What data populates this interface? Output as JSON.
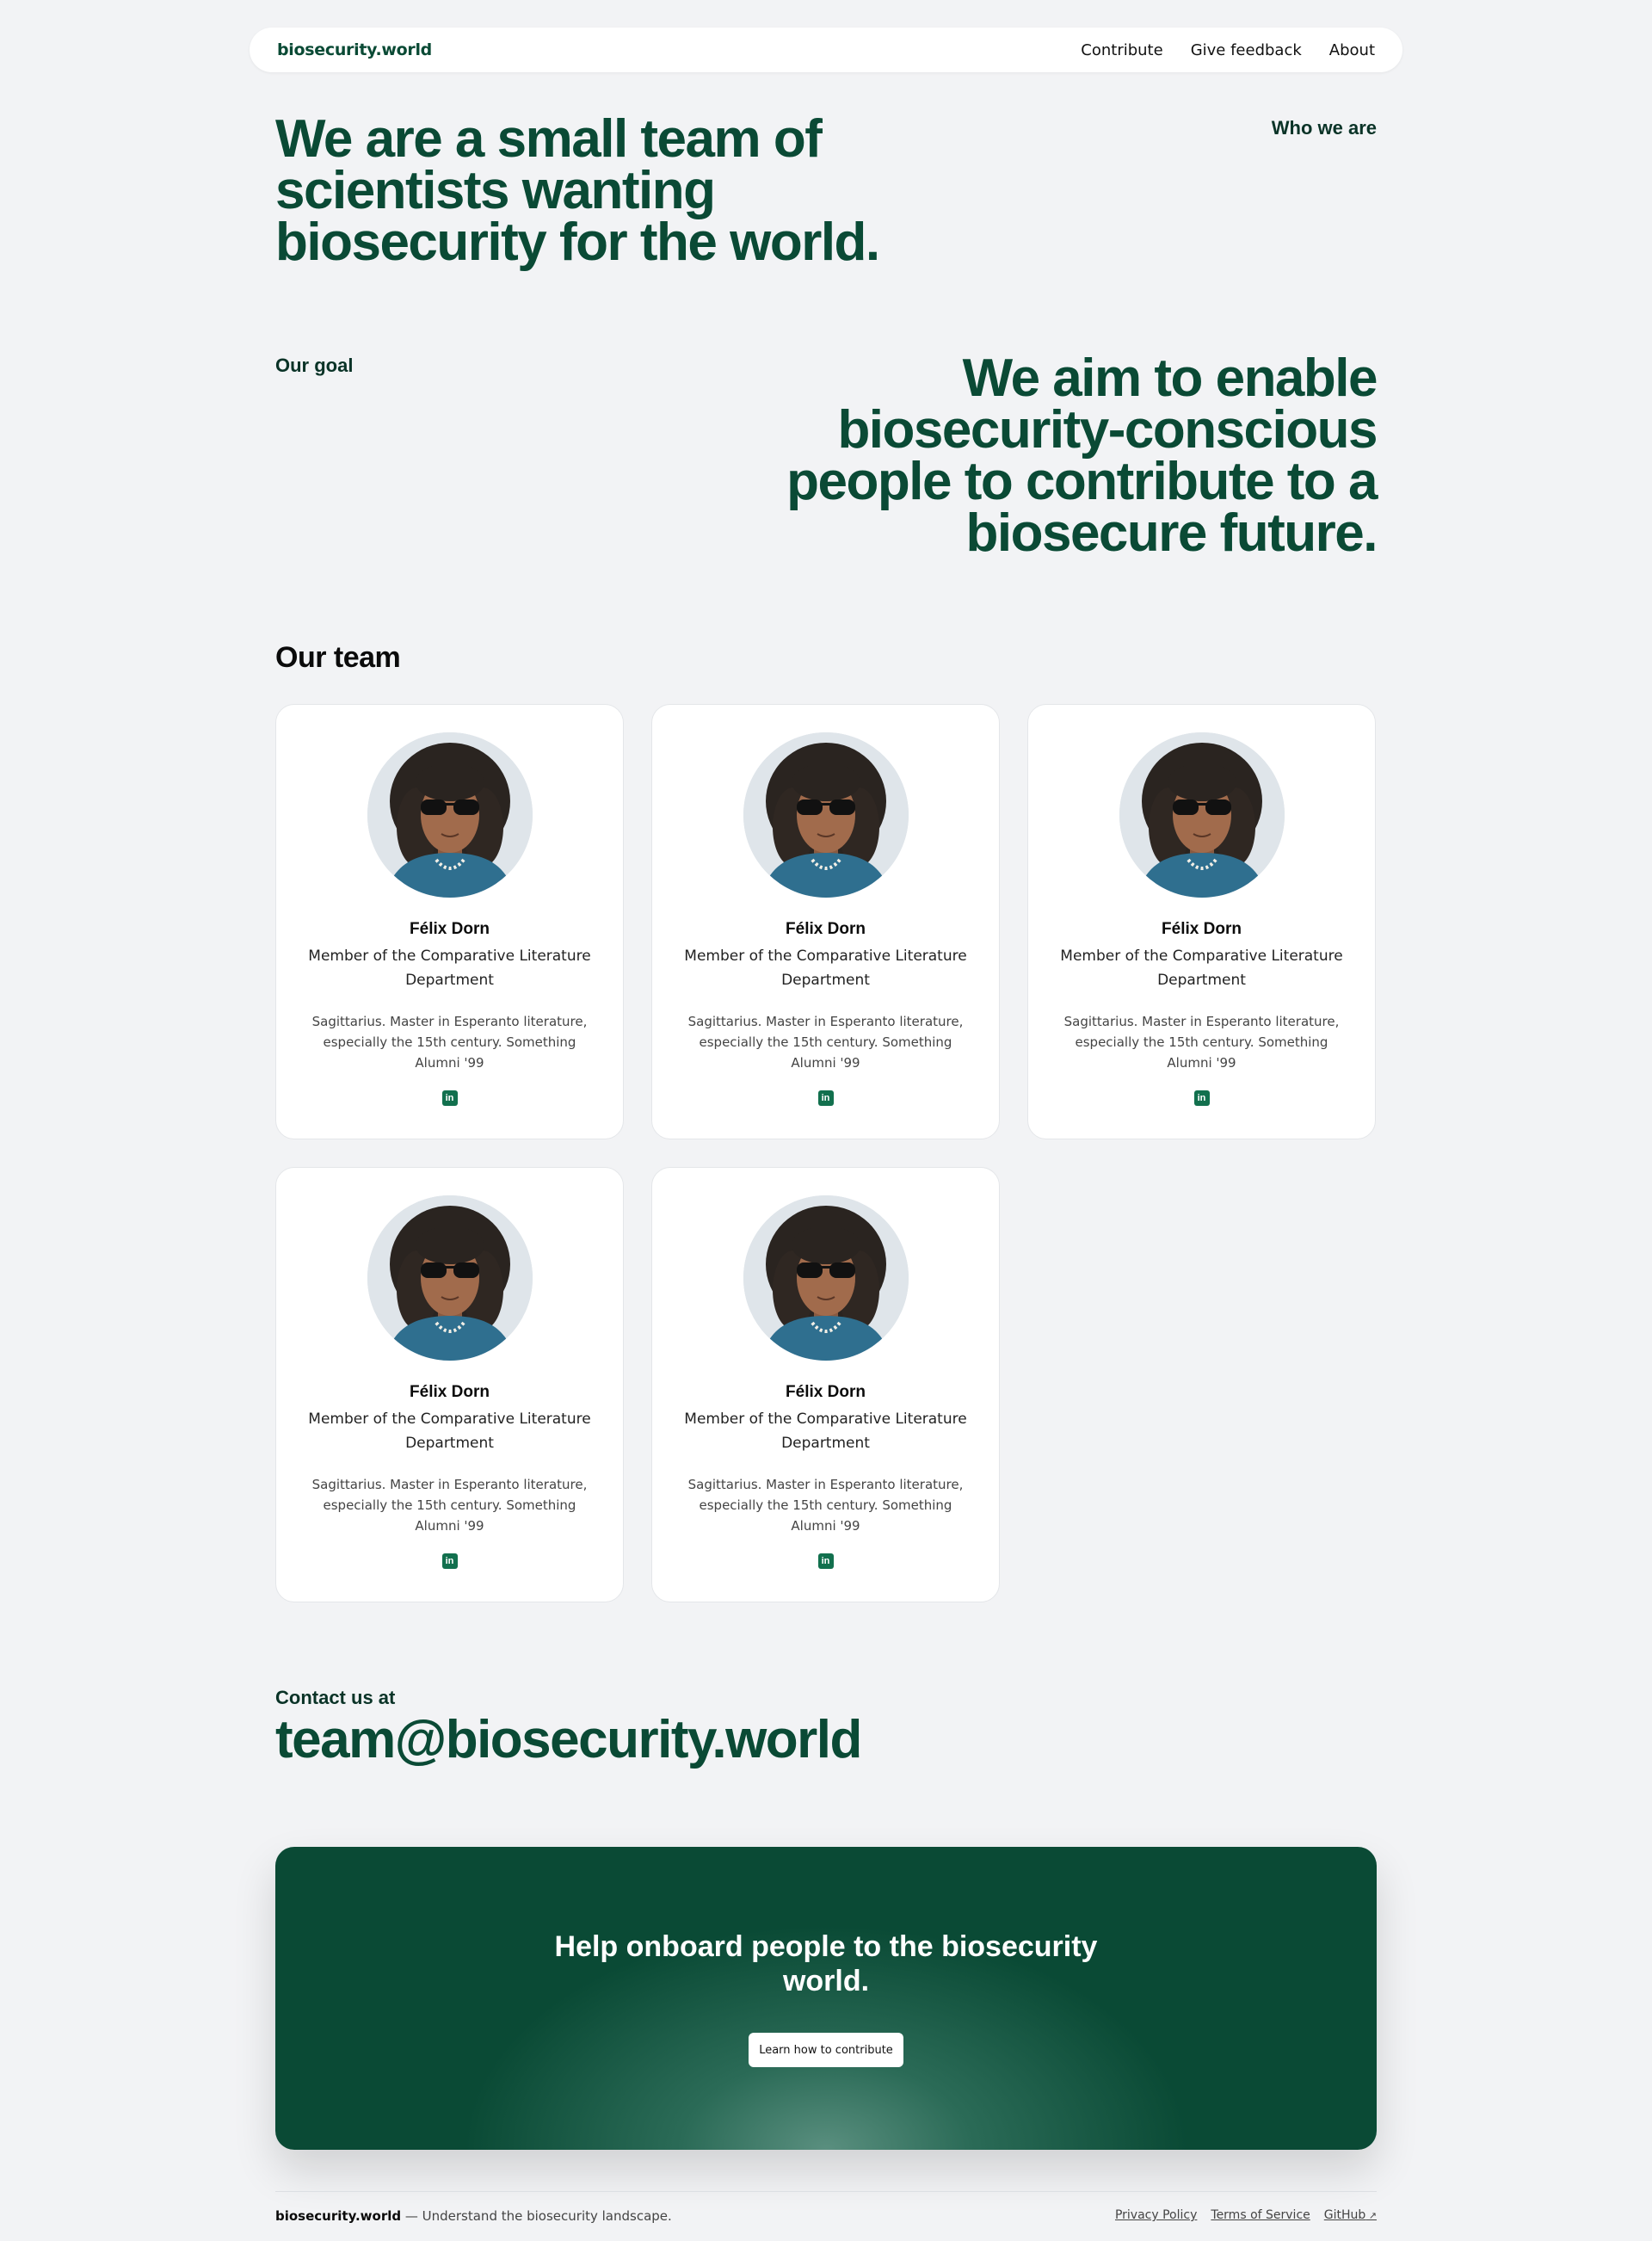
{
  "nav": {
    "brand": "biosecurity.world",
    "links": [
      "Contribute",
      "Give feedback",
      "About"
    ]
  },
  "hero": {
    "title": "We are a small team of scientists wanting biosecurity for the world.",
    "section_label": "Who we are"
  },
  "goal": {
    "label": "Our goal",
    "text": "We aim to enable biosecurity-conscious people to contribute to a biosecure future."
  },
  "team": {
    "title": "Our team",
    "members": [
      {
        "name": "Félix Dorn",
        "role": "Member of the Comparative Literature Department",
        "bio": "Sagittarius. Master in Esperanto literature, especially the 15th century. Something Alumni '99",
        "icon": "linkedin-icon"
      },
      {
        "name": "Félix Dorn",
        "role": "Member of the Comparative Literature Department",
        "bio": "Sagittarius. Master in Esperanto literature, especially the 15th century. Something Alumni '99",
        "icon": "linkedin-icon"
      },
      {
        "name": "Félix Dorn",
        "role": "Member of the Comparative Literature Department",
        "bio": "Sagittarius. Master in Esperanto literature, especially the 15th century. Something Alumni '99",
        "icon": "linkedin-icon"
      },
      {
        "name": "Félix Dorn",
        "role": "Member of the Comparative Literature Department",
        "bio": "Sagittarius. Master in Esperanto literature, especially the 15th century. Something Alumni '99",
        "icon": "linkedin-icon"
      },
      {
        "name": "Félix Dorn",
        "role": "Member of the Comparative Literature Department",
        "bio": "Sagittarius. Master in Esperanto literature, especially the 15th century. Something Alumni '99",
        "icon": "linkedin-icon"
      }
    ]
  },
  "contact": {
    "label": "Contact us at",
    "email": "team@biosecurity.world"
  },
  "cta": {
    "title": "Help onboard people to the biosecurity world.",
    "button": "Learn how to contribute"
  },
  "footer": {
    "brand": "biosecurity.world",
    "tagline": " — Understand the biosecurity landscape.",
    "links": [
      "Privacy Policy",
      "Terms of Service",
      "GitHub"
    ]
  },
  "colors": {
    "background": "#f2f3f5",
    "brand_green": "#0a4a35",
    "linkedin_green": "#12704e"
  }
}
